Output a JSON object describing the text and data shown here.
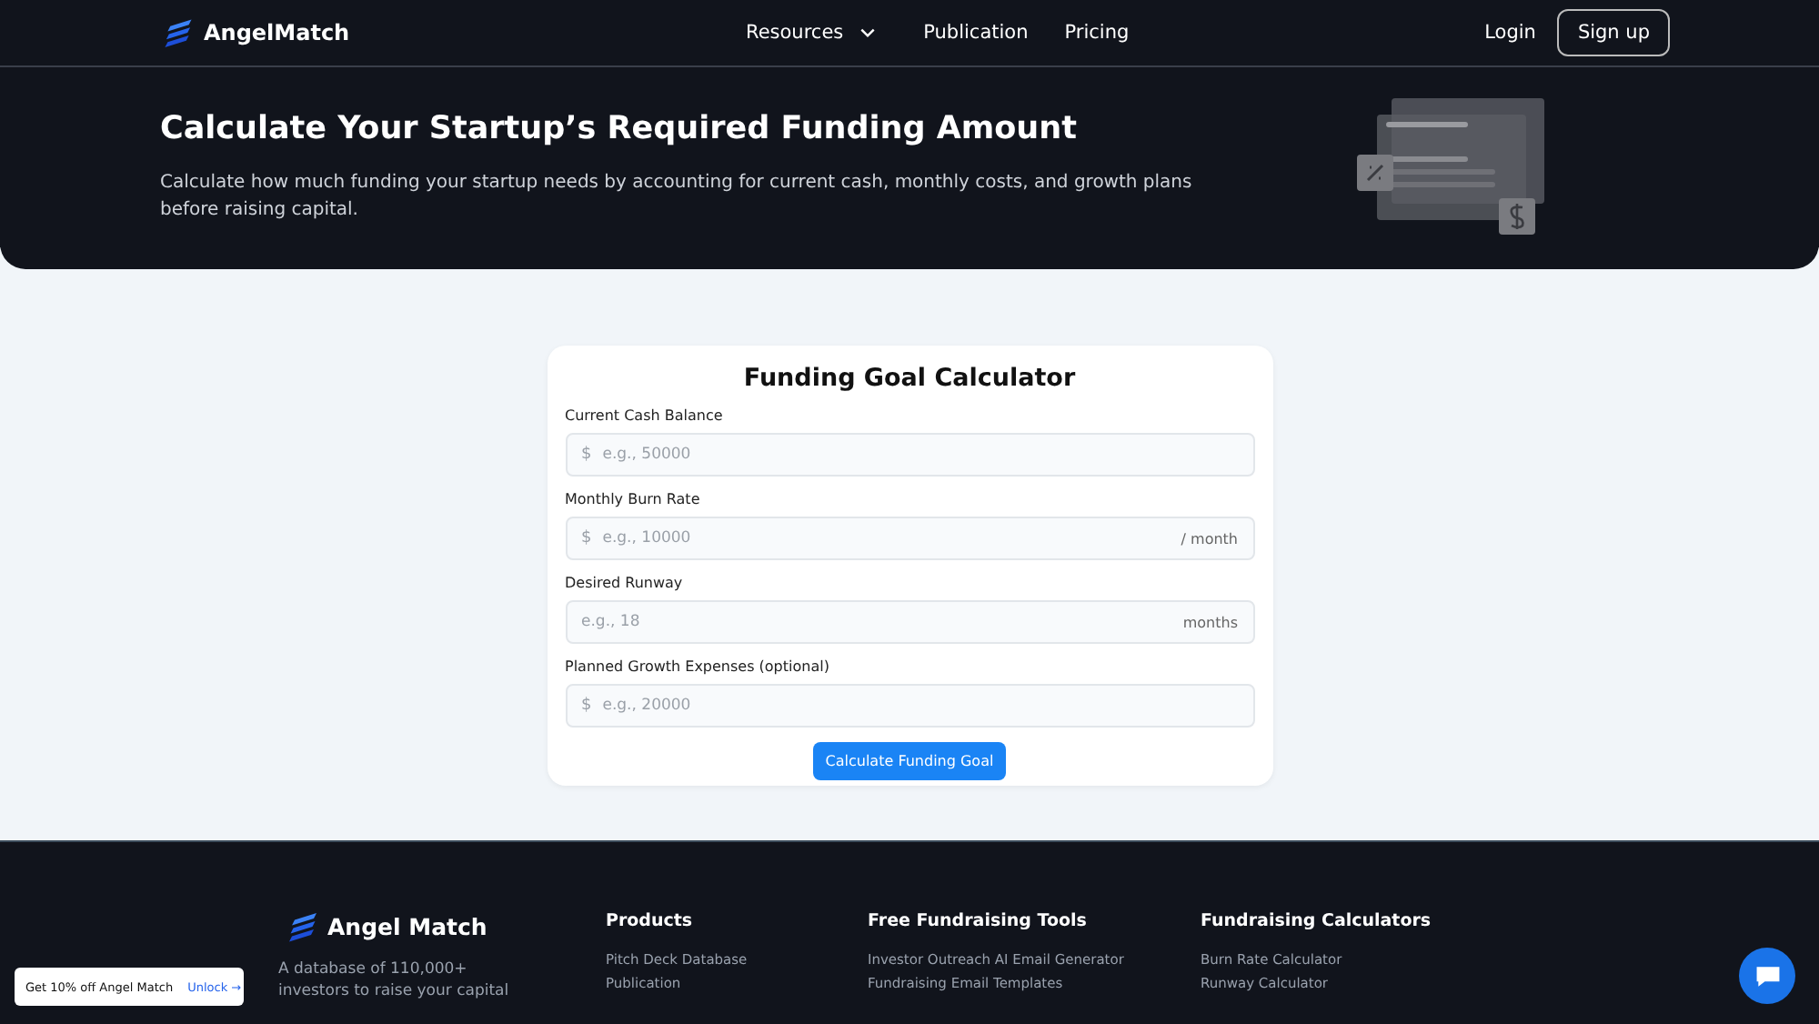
{
  "nav": {
    "brand": "AngelMatch",
    "links": [
      {
        "label": "Resources",
        "dropdown": true
      },
      {
        "label": "Publication",
        "dropdown": false
      },
      {
        "label": "Pricing",
        "dropdown": false
      }
    ],
    "login": "Login",
    "signup": "Sign up"
  },
  "hero": {
    "title": "Calculate Your Startup’s Required Funding Amount",
    "subtitle": "Calculate how much funding your startup needs by accounting for current cash, monthly costs, and growth plans before raising capital."
  },
  "calculator": {
    "title": "Funding Goal Calculator",
    "fields": [
      {
        "label": "Current Cash Balance",
        "prefix": "$",
        "placeholder": "e.g., 50000"
      },
      {
        "label": "Monthly Burn Rate",
        "prefix": "$",
        "placeholder": "e.g., 10000",
        "suffix": "/ month"
      },
      {
        "label": "Desired Runway",
        "placeholder": "e.g., 18",
        "suffix": "months"
      },
      {
        "label": "Planned Growth Expenses (optional)",
        "prefix": "$",
        "placeholder": "e.g., 20000"
      }
    ],
    "button": "Calculate Funding Goal"
  },
  "footer": {
    "brand": "Angel Match",
    "description": "A database of 110,000+ investors to raise your capital",
    "columns": [
      {
        "heading": "Products",
        "links": [
          "Pitch Deck Database",
          "Publication"
        ]
      },
      {
        "heading": "Free Fundraising Tools",
        "links": [
          "Investor Outreach AI Email Generator",
          "Fundraising Email Templates"
        ]
      },
      {
        "heading": "Fundraising Calculators",
        "links": [
          "Burn Rate Calculator",
          "Runway Calculator"
        ]
      }
    ]
  },
  "promo": {
    "text": "Get 10% off Angel Match",
    "link": "Unlock →"
  }
}
